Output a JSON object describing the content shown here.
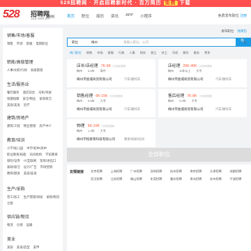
{
  "topbar": {
    "pre": "528招聘网 · 开启招聘新时代 · 百万简历",
    "hl": "免费",
    "post": "下载"
  },
  "header": {
    "logo": "528",
    "logo_cn": "招聘网",
    "logo_url": "528.com.cn",
    "city": "梅州"
  },
  "nav": [
    "首页",
    "职位",
    "简历",
    "资讯",
    "APP",
    "小程序"
  ],
  "login": {
    "text": "免费发布职位",
    "reg": "注册"
  },
  "sidebar": [
    {
      "title": "销售/市场/客服",
      "items": [
        "销售",
        "市场",
        "客服",
        "电销职位"
      ]
    },
    {
      "title": "职能/高级管理",
      "items": [
        "人事/文职/行政",
        "高级管理"
      ]
    },
    {
      "title": "生活/服务业",
      "items": [
        "餐饮服务",
        "酒店前台",
        "司机/驾驶",
        "保健按摩",
        "安全/物业",
        "家政保洁",
        "美容/美发",
        "足疗"
      ]
    },
    {
      "title": "建筑/房地产",
      "items": [
        "建筑/工程",
        "物业管理",
        "房产中介"
      ]
    },
    {
      "title": "教育/培训",
      "items": [
        "小学/幼儿园",
        "中学/初中/高中",
        "职业教育/技能",
        "培训机构",
        "学前教育",
        "保险/证券",
        "IT/互联网",
        "贸易/进出口",
        "家政/保洁",
        "设计/广告",
        "市场营销",
        "教练/健身",
        "美容/美发"
      ]
    },
    {
      "title": "生产/采购",
      "items": [
        "普工/技工",
        "生产管理/研发",
        "采购/物流",
        "仓管"
      ]
    },
    {
      "title": "供应链/物流",
      "items": [
        "物流",
        "仓储",
        "运输"
      ]
    },
    {
      "title": "美业",
      "items": [
        "美容",
        "美发/造型",
        "美甲"
      ]
    }
  ],
  "publish": {
    "label": "发布职位",
    "action": "找简历"
  },
  "search": {
    "sel1": "职位",
    "sel2": "梅州",
    "placeholder": "请输入职位、公司",
    "button": "🔍"
  },
  "tabs": [
    "热门职位",
    "销售",
    "市场",
    "客服",
    "行政",
    "人事",
    "财务",
    "普工",
    "技工",
    "司机",
    "餐饮",
    "服务",
    "更多"
  ],
  "jobs": [
    {
      "title": "店长/店经理",
      "salary": "7K-9K",
      "ago": "7分钟前更新",
      "meta": [
        "梅州",
        "5-8年",
        "高中"
      ],
      "company": "梅州市屋城商贸有限公司",
      "industry": "汽车/摩托车"
    },
    {
      "title": "店经理",
      "salary": "20K-40K",
      "ago": "7分钟前更新",
      "meta": [
        "梅州",
        "10年以上",
        "大专"
      ],
      "company": "梅州市屋城商贸有限公司",
      "industry": "汽车/摩托车"
    },
    {
      "title": "销售经理",
      "salary": "6K-15K",
      "ago": "7分钟前更新",
      "meta": [
        "梅州",
        "5-8年",
        "大专"
      ],
      "company": "梅州市屋城商贸有限公司",
      "industry": "汽车/摩托车"
    },
    {
      "title": "售后经理",
      "salary": "7K-8K",
      "ago": "7分钟前更新",
      "meta": [
        "梅州",
        "3-5年",
        "大专"
      ],
      "company": "梅州市屋城商贸有限公司",
      "industry": "汽车/摩托车"
    },
    {
      "title": "物理",
      "salary": "5K-10K",
      "ago": "7分钟前更新",
      "meta": [
        "梅州",
        "1-3年",
        "大专"
      ],
      "company": "梅州学程教育科技有限公司",
      "industry": "教育/科研/培训"
    }
  ],
  "all_button": "全部职位",
  "links": {
    "label": "友情链接",
    "items": [
      "北京招聘",
      "上海招聘",
      "广州招聘",
      "深圳招聘",
      "杭州招聘",
      "南京招聘",
      "天津招聘",
      "成都招聘",
      "武汉招聘",
      "江苏招聘",
      "佛山招聘",
      "东莞招聘",
      "重庆招聘",
      "青岛招聘",
      "苏州招聘",
      "宁波招聘"
    ]
  }
}
